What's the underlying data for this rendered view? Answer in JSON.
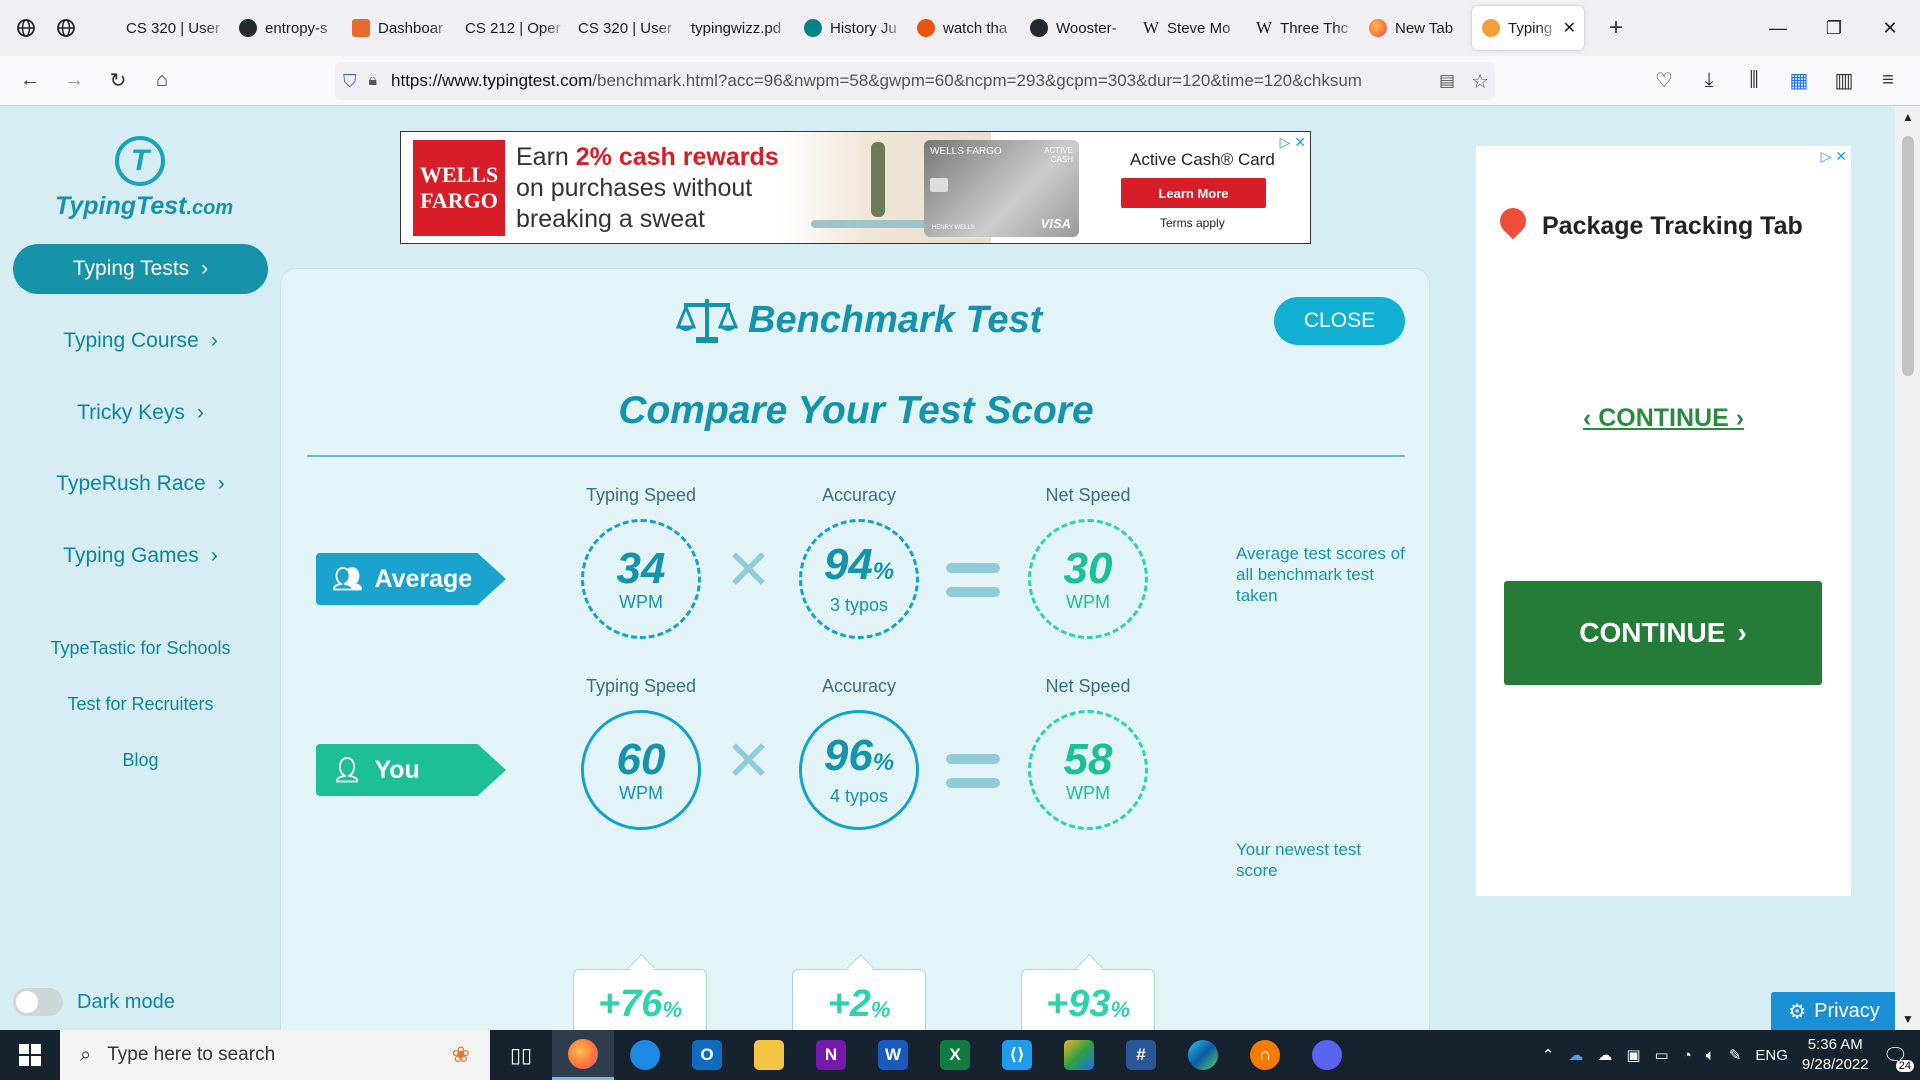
{
  "browser": {
    "tabs": [
      {
        "label": "CS 320 | User",
        "color": "#ffffff"
      },
      {
        "label": "entropy-s",
        "color": "#24292f"
      },
      {
        "label": "Dashboar",
        "color": "#e8692c"
      },
      {
        "label": "CS 212 | Oper",
        "color": "#ffffff"
      },
      {
        "label": "CS 320 | User",
        "color": "#ffffff"
      },
      {
        "label": "typingwizz.pd",
        "color": "#ffffff"
      },
      {
        "label": "History Ju",
        "color": "#038387"
      },
      {
        "label": "watch tha",
        "color": "#e8550c"
      },
      {
        "label": "Wooster-",
        "color": "#24292f"
      },
      {
        "label": "Steve Mo",
        "color": "#ffffff"
      },
      {
        "label": "Three Thc",
        "color": "#ffffff"
      },
      {
        "label": "New Tab",
        "color": "#ff7139"
      },
      {
        "label": "Typing",
        "color": "#f29e38"
      }
    ],
    "url_host": "https://www.typingtest.com",
    "url_path": "/benchmark.html?acc=96&nwpm=58&gwpm=60&ncpm=293&gcpm=303&dur=120&time=120&chksum"
  },
  "sidebar": {
    "logo_text": "TypingTest",
    "logo_suffix": ".com",
    "items": [
      {
        "label": "Typing Tests"
      },
      {
        "label": "Typing Course"
      },
      {
        "label": "Tricky Keys"
      },
      {
        "label": "TypeRush Race"
      },
      {
        "label": "Typing Games"
      }
    ],
    "links": [
      "TypeTastic for Schools",
      "Test for Recruiters",
      "Blog"
    ],
    "dark_mode_label": "Dark mode"
  },
  "ad_top": {
    "brand_line1": "WELLS",
    "brand_line2": "FARGO",
    "headline_pre": "Earn ",
    "headline_bold": "2% cash rewards",
    "headline_line2": "on purchases without",
    "headline_line3": "breaking a sweat",
    "card_brand": "WELLS FARGO",
    "card_tag": "ACTIVE CASH",
    "card_name": "HENRY WELLS",
    "card_network": "VISA",
    "product": "Active Cash® Card",
    "cta": "Learn More",
    "terms": "Terms apply"
  },
  "benchmark": {
    "title": "Benchmark Test",
    "close_label": "CLOSE",
    "subtitle": "Compare Your Test Score",
    "col_speed": "Typing Speed",
    "col_accuracy": "Accuracy",
    "col_net": "Net Speed",
    "average": {
      "label": "Average",
      "speed": "34",
      "speed_unit": "WPM",
      "accuracy": "94",
      "accuracy_unit": "%",
      "typos": "3 typos",
      "net": "30",
      "net_unit": "WPM",
      "note": "Average test scores of all benchmark test taken"
    },
    "you": {
      "label": "You",
      "speed": "60",
      "speed_unit": "WPM",
      "accuracy": "96",
      "accuracy_unit": "%",
      "typos": "4 typos",
      "net": "58",
      "net_unit": "WPM",
      "note": "Your newest test score"
    },
    "diffs": [
      {
        "value": "+76",
        "unit": "%"
      },
      {
        "value": "+2",
        "unit": "%"
      },
      {
        "value": "+93",
        "unit": "%"
      }
    ]
  },
  "ad_right": {
    "title": "Package Tracking Tab",
    "continue_link": "CONTINUE",
    "continue_button": "CONTINUE"
  },
  "privacy_label": "Privacy",
  "taskbar": {
    "search_placeholder": "Type here to search",
    "language": "ENG",
    "time": "5:36 AM",
    "date": "9/28/2022",
    "notifications": "24"
  }
}
